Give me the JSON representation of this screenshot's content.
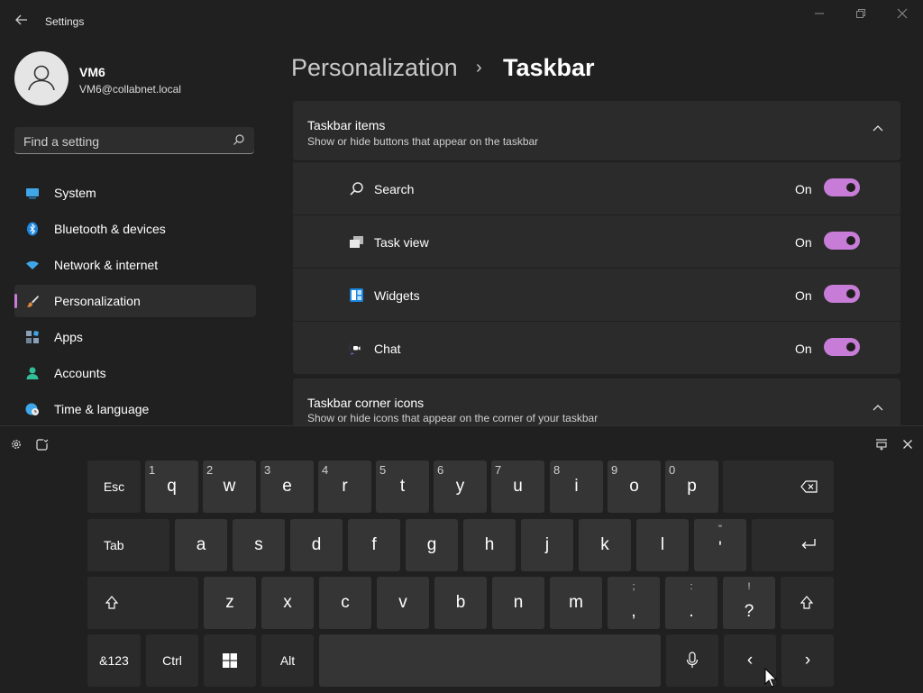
{
  "window": {
    "title": "Settings"
  },
  "profile": {
    "name": "VM6",
    "email": "VM6@collabnet.local"
  },
  "search": {
    "placeholder": "Find a setting"
  },
  "nav": {
    "items": [
      {
        "label": "System",
        "icon": "system-icon",
        "active": false
      },
      {
        "label": "Bluetooth & devices",
        "icon": "bluetooth-icon",
        "active": false
      },
      {
        "label": "Network & internet",
        "icon": "wifi-icon",
        "active": false
      },
      {
        "label": "Personalization",
        "icon": "brush-icon",
        "active": true
      },
      {
        "label": "Apps",
        "icon": "apps-icon",
        "active": false
      },
      {
        "label": "Accounts",
        "icon": "accounts-icon",
        "active": false
      },
      {
        "label": "Time & language",
        "icon": "globe-clock-icon",
        "active": false
      }
    ]
  },
  "header": {
    "parent": "Personalization",
    "separator": "›",
    "current": "Taskbar"
  },
  "taskbar_items": {
    "title": "Taskbar items",
    "subtitle": "Show or hide buttons that appear on the taskbar",
    "rows": [
      {
        "label": "Search",
        "state": "On",
        "on": true,
        "icon": "search-icon"
      },
      {
        "label": "Task view",
        "state": "On",
        "on": true,
        "icon": "task-view-icon"
      },
      {
        "label": "Widgets",
        "state": "On",
        "on": true,
        "icon": "widgets-icon"
      },
      {
        "label": "Chat",
        "state": "On",
        "on": true,
        "icon": "chat-icon"
      }
    ]
  },
  "corner_icons": {
    "title": "Taskbar corner icons",
    "subtitle": "Show or hide icons that appear on the corner of your taskbar"
  },
  "keyboard": {
    "row1": [
      {
        "label": "Esc"
      },
      {
        "label": "q",
        "num": "1"
      },
      {
        "label": "w",
        "num": "2"
      },
      {
        "label": "e",
        "num": "3"
      },
      {
        "label": "r",
        "num": "4"
      },
      {
        "label": "t",
        "num": "5"
      },
      {
        "label": "y",
        "num": "6"
      },
      {
        "label": "u",
        "num": "7"
      },
      {
        "label": "i",
        "num": "8"
      },
      {
        "label": "o",
        "num": "9"
      },
      {
        "label": "p",
        "num": "0"
      }
    ],
    "row2": [
      {
        "label": "Tab"
      },
      {
        "label": "a"
      },
      {
        "label": "s"
      },
      {
        "label": "d"
      },
      {
        "label": "f"
      },
      {
        "label": "g"
      },
      {
        "label": "h"
      },
      {
        "label": "j"
      },
      {
        "label": "k"
      },
      {
        "label": "l"
      }
    ],
    "quote_key": {
      "top": "\"",
      "bottom": "'"
    },
    "row3": [
      {
        "label": "z"
      },
      {
        "label": "x"
      },
      {
        "label": "c"
      },
      {
        "label": "v"
      },
      {
        "label": "b"
      },
      {
        "label": "n"
      },
      {
        "label": "m"
      }
    ],
    "comma_key": {
      "top": ";",
      "bottom": ","
    },
    "period_key": {
      "top": ":",
      "bottom": "."
    },
    "question_key": {
      "top": "!",
      "bottom": "?"
    },
    "symbols_label": "&123",
    "ctrl_label": "Ctrl",
    "alt_label": "Alt",
    "left_arrow": "‹",
    "right_arrow": "›"
  }
}
